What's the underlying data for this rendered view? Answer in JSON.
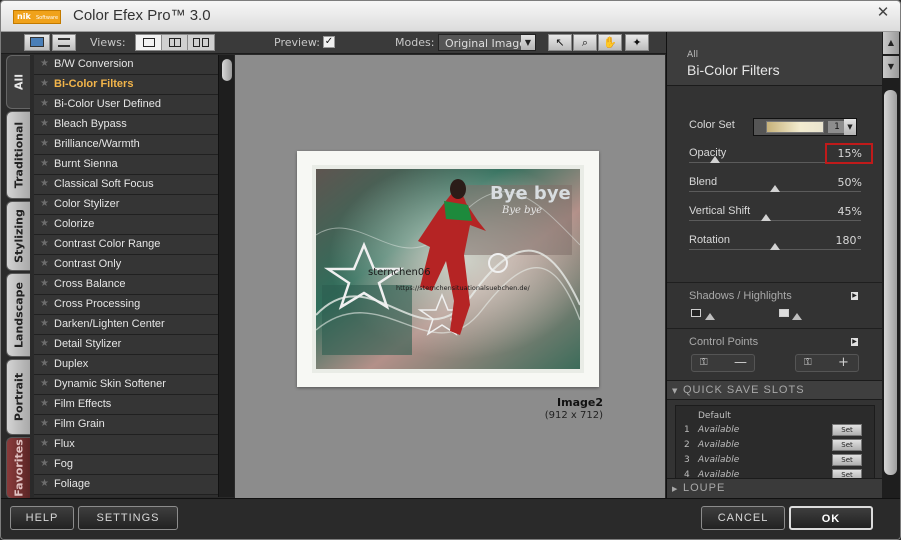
{
  "window": {
    "title": "Color Efex Pro™ 3.0",
    "close_glyph": "✕"
  },
  "logo": {
    "text": "nik",
    "sub": "Software"
  },
  "toolbar": {
    "views_label": "Views:",
    "preview_label": "Preview:",
    "preview_checked": "✓",
    "modes_label": "Modes:",
    "mode_value": "Original Image",
    "tool_glyphs": [
      "↖",
      "⌕",
      "✋",
      "✦"
    ]
  },
  "left_tabs": [
    {
      "label": "All",
      "active": true
    },
    {
      "label": "Traditional",
      "active": false
    },
    {
      "label": "Stylizing",
      "active": false
    },
    {
      "label": "Landscape",
      "active": false
    },
    {
      "label": "Portrait",
      "active": false
    },
    {
      "label": "Favorites",
      "active": false
    }
  ],
  "filters": [
    "B/W Conversion",
    "Bi-Color Filters",
    "Bi-Color User Defined",
    "Bleach Bypass",
    "Brilliance/Warmth",
    "Burnt Sienna",
    "Classical Soft Focus",
    "Color Stylizer",
    "Colorize",
    "Contrast Color Range",
    "Contrast Only",
    "Cross Balance",
    "Cross Processing",
    "Darken/Lighten Center",
    "Detail Stylizer",
    "Duplex",
    "Dynamic Skin Softener",
    "Film Effects",
    "Film Grain",
    "Flux",
    "Fog",
    "Foliage"
  ],
  "selected_filter_index": 1,
  "preview": {
    "image_name": "Image2",
    "image_size": "(912 x 712)",
    "overlay_title": "Bye bye",
    "overlay_subtitle": "Bye bye",
    "watermark_1": "sternchen06",
    "watermark_2": "https://sternchensituationalsuebchen.de/"
  },
  "right_panel": {
    "crumb": "All",
    "title": "Bi-Color Filters",
    "color_set": {
      "label": "Color Set",
      "value": "1"
    },
    "params": [
      {
        "label": "Opacity",
        "value": "15%",
        "fraction": 0.15
      },
      {
        "label": "Blend",
        "value": "50%",
        "fraction": 0.5
      },
      {
        "label": "Vertical Shift",
        "value": "45%",
        "fraction": 0.45
      },
      {
        "label": "Rotation",
        "value": "180°",
        "fraction": 0.5
      }
    ],
    "shadows_highlights": "Shadows / Highlights",
    "control_points": "Control Points",
    "cp_add_glyph": "—",
    "cp_remove_glyph": "+",
    "quick_save": {
      "title": "QUICK SAVE SLOTS",
      "default_label": "Default",
      "slots": [
        {
          "num": "1",
          "text": "Available",
          "button": "Set"
        },
        {
          "num": "2",
          "text": "Available",
          "button": "Set"
        },
        {
          "num": "3",
          "text": "Available",
          "button": "Set"
        },
        {
          "num": "4",
          "text": "Available",
          "button": "Set"
        }
      ]
    },
    "loupe": "LOUPE"
  },
  "bottom": {
    "help": "HELP",
    "settings": "SETTINGS",
    "cancel": "CANCEL",
    "ok": "OK"
  },
  "colors": {
    "selected_filter": "#f3b54a",
    "opacity_highlight": "#c01a1a"
  }
}
